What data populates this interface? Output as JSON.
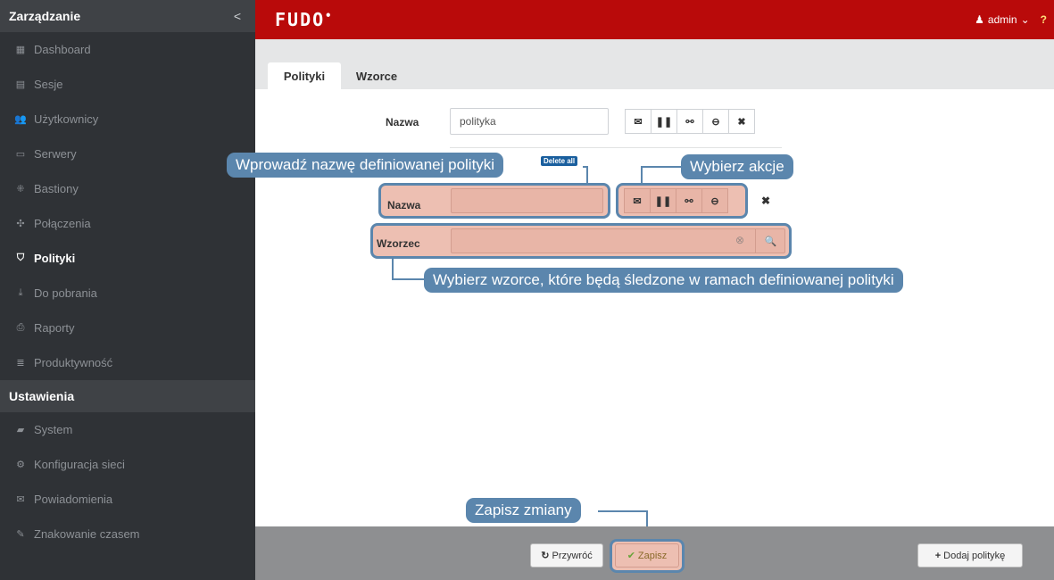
{
  "sidebar": {
    "header": "Zarządzanie",
    "collapse_glyph": "<",
    "items": [
      {
        "icon": "dashboard-icon",
        "glyph": "▦",
        "label": "Dashboard"
      },
      {
        "icon": "sessions-icon",
        "glyph": "▤",
        "label": "Sesje"
      },
      {
        "icon": "users-icon",
        "glyph": "👥",
        "label": "Użytkownicy"
      },
      {
        "icon": "server-icon",
        "glyph": "▭",
        "label": "Serwery"
      },
      {
        "icon": "bastion-icon",
        "glyph": "⁜",
        "label": "Bastiony"
      },
      {
        "icon": "connections-icon",
        "glyph": "✣",
        "label": "Połączenia"
      },
      {
        "icon": "shield-icon",
        "glyph": "⛉",
        "label": "Polityki",
        "active": true
      },
      {
        "icon": "download-icon",
        "glyph": "⤓",
        "label": "Do pobrania"
      },
      {
        "icon": "print-icon",
        "glyph": "⎙",
        "label": "Raporty"
      },
      {
        "icon": "productivity-icon",
        "glyph": "≣",
        "label": "Produktywność"
      }
    ],
    "section2": "Ustawienia",
    "items2": [
      {
        "icon": "folder-icon",
        "glyph": "▰",
        "label": "System"
      },
      {
        "icon": "gears-icon",
        "glyph": "⚙",
        "label": "Konfiguracja sieci"
      },
      {
        "icon": "envelope-icon",
        "glyph": "✉",
        "label": "Powiadomienia"
      },
      {
        "icon": "edit-icon",
        "glyph": "✎",
        "label": "Znakowanie czasem"
      }
    ]
  },
  "topbar": {
    "logo": "FUDO",
    "logo_mark": "•",
    "user_glyph": "♟",
    "user": "admin",
    "user_caret": "⌄",
    "help_glyph": "?"
  },
  "tabs": {
    "policies": "Polityki",
    "patterns": "Wzorce"
  },
  "form": {
    "name_label": "Nazwa",
    "name_value": "polityka",
    "delete_all": "Delete all",
    "row_name_label": "Nazwa",
    "pattern_label": "Wzorzec",
    "action_glyphs": {
      "email": "✉",
      "pause": "❚❚",
      "disconnect": "⚯",
      "block": "⊖",
      "remove": "✖",
      "clear": "⊗",
      "search": "🔍"
    }
  },
  "callouts": {
    "name": "Wprowadź nazwę definiowanej polityki",
    "actions": "Wybierz akcje",
    "patterns": "Wybierz wzorce, które będą śledzone w ramach definiowanej polityki",
    "save": "Zapisz zmiany"
  },
  "footer": {
    "restore_glyph": "↻",
    "restore": "Przywróć",
    "save_glyph": "✔",
    "save": "Zapisz",
    "add_glyph": "+",
    "add_policy": "Dodaj politykę"
  },
  "colors": {
    "topbar": "#b90a0a",
    "sidebar": "#2f3236",
    "callout": "#5b86ad",
    "highlight": "#edbfb2",
    "footer": "#8e8f91"
  }
}
